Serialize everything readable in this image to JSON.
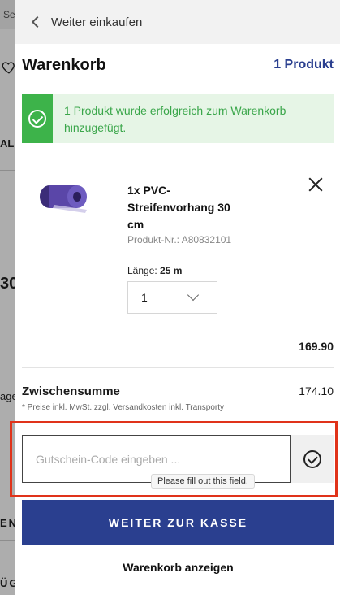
{
  "background": {
    "search_fragment": "Se",
    "fragment_al": "AL",
    "fragment_30": "30",
    "fragment_age": "age",
    "fragment_en": "EN",
    "fragment_ug": "ÜG"
  },
  "nav": {
    "back_label": "Weiter einkaufen"
  },
  "cart": {
    "title": "Warenkorb",
    "count_label": "1 Produkt"
  },
  "notice": {
    "message": "1 Produkt wurde erfolgreich zum Warenkorb hinzugefügt."
  },
  "item": {
    "name": "1x PVC-Streifenvorhang 30 cm",
    "sku": "Produkt-Nr.: A80832101",
    "length_label": "Länge:",
    "length_value": "25 m",
    "quantity": "1",
    "price": "169.90"
  },
  "summary": {
    "subtotal_label": "Zwischensumme",
    "subtotal_value": "174.10",
    "note": "* Preise inkl. MwSt. zzgl. Versandkosten inkl. Transporty"
  },
  "coupon": {
    "placeholder": "Gutschein-Code eingeben ...",
    "tooltip": "Please fill out this field."
  },
  "actions": {
    "checkout_label": "WEITER ZUR KASSE",
    "view_cart_label": "Warenkorb anzeigen"
  },
  "colors": {
    "brand": "#2a3f8f",
    "success": "#3db34a",
    "highlight": "#e0331a"
  }
}
